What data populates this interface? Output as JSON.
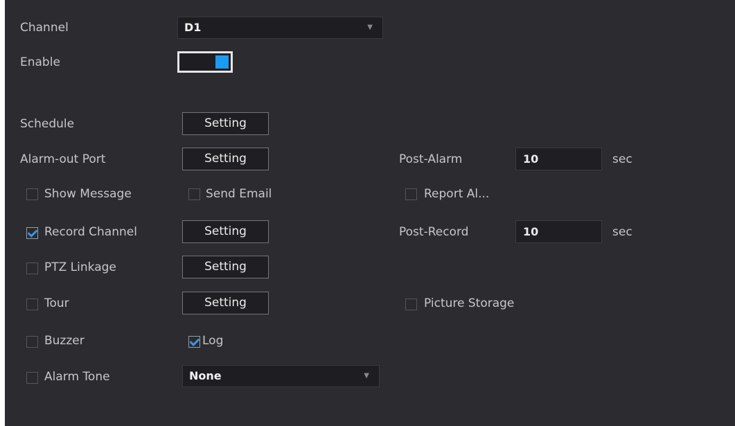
{
  "channel": {
    "label": "Channel",
    "value": "D1"
  },
  "enable": {
    "label": "Enable",
    "on": true
  },
  "schedule": {
    "label": "Schedule",
    "button": "Setting"
  },
  "alarm_out": {
    "label": "Alarm-out Port",
    "button": "Setting"
  },
  "post_alarm": {
    "label": "Post-Alarm",
    "value": "10",
    "unit": "sec"
  },
  "show_message": {
    "label": "Show Message",
    "checked": false
  },
  "send_email": {
    "label": "Send Email",
    "checked": false
  },
  "report_alarm": {
    "label": "Report Al...",
    "checked": false
  },
  "record_channel": {
    "label": "Record Channel",
    "checked": true,
    "button": "Setting"
  },
  "post_record": {
    "label": "Post-Record",
    "value": "10",
    "unit": "sec"
  },
  "ptz_linkage": {
    "label": "PTZ Linkage",
    "checked": false,
    "button": "Setting"
  },
  "tour": {
    "label": "Tour",
    "checked": false,
    "button": "Setting"
  },
  "picture_storage": {
    "label": "Picture Storage",
    "checked": false
  },
  "buzzer": {
    "label": "Buzzer",
    "checked": false
  },
  "log": {
    "label": "Log",
    "checked": true
  },
  "alarm_tone": {
    "label": "Alarm Tone",
    "checked": false,
    "value": "None"
  },
  "colors": {
    "accent": "#1c9bf2",
    "background": "#2c2c30",
    "check": "#3f93e0"
  }
}
